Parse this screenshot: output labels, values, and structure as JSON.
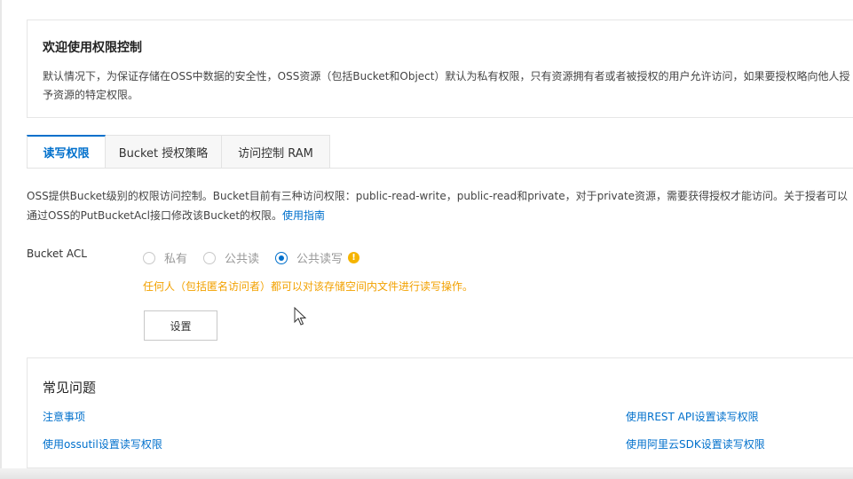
{
  "welcome": {
    "title": "欢迎使用权限控制",
    "text": "默认情况下，为保证存储在OSS中数据的安全性，OSS资源（包括Bucket和Object）默认为私有权限，只有资源拥有者或者被授权的用户允许访问，如果要授权略向他人授予资源的特定权限。"
  },
  "tabs": [
    {
      "label": "读写权限"
    },
    {
      "label": "Bucket 授权策略"
    },
    {
      "label": "访问控制 RAM"
    }
  ],
  "description": {
    "text": "OSS提供Bucket级别的权限访问控制。Bucket目前有三种访问权限：public-read-write，public-read和private，对于private资源，需要获得授权才能访问。关于授者可以通过OSS的PutBucketAcl接口修改该Bucket的权限。",
    "link": "使用指南"
  },
  "acl": {
    "label": "Bucket ACL",
    "options": [
      {
        "label": "私有"
      },
      {
        "label": "公共读"
      },
      {
        "label": "公共读写"
      }
    ],
    "warning_icon": "!",
    "warning": "任何人（包括匿名访问者）都可以对该存储空间内文件进行读写操作。",
    "button": "设置"
  },
  "faq": {
    "title": "常见问题",
    "links": [
      {
        "label": "注意事项"
      },
      {
        "label": "使用REST API设置读写权限"
      },
      {
        "label": "使用ossutil设置读写权限"
      },
      {
        "label": "使用阿里云SDK设置读写权限"
      }
    ]
  },
  "colors": {
    "accent": "#0070cc",
    "warning": "#f2a100"
  }
}
